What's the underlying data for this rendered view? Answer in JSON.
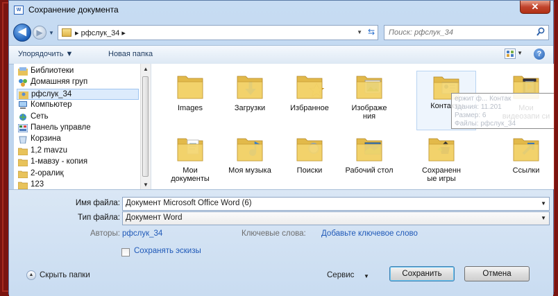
{
  "window": {
    "title": "Сохранение документа",
    "close_label": "✕"
  },
  "nav": {
    "crumb": "рфслук_34",
    "search_placeholder": "Поиск: рфслук_34"
  },
  "toolbar": {
    "organize_label": "Упорядочить ▼",
    "new_folder_label": "Новая папка"
  },
  "tree": {
    "items": [
      {
        "label": "Библиотеки",
        "icon": "libraries-icon"
      },
      {
        "label": "Домашняя груп",
        "icon": "homegroup-icon"
      },
      {
        "label": "рфслук_34",
        "icon": "user-folder-icon",
        "selected": true
      },
      {
        "label": "Компьютер",
        "icon": "computer-icon"
      },
      {
        "label": "Сеть",
        "icon": "network-icon"
      },
      {
        "label": "Панель управле",
        "icon": "control-panel-icon"
      },
      {
        "label": "Корзина",
        "icon": "recycle-bin-icon"
      },
      {
        "label": "1,2 mavzu",
        "icon": "folder-icon"
      },
      {
        "label": "1-мавзу - копия",
        "icon": "folder-icon"
      },
      {
        "label": "2-оралиқ",
        "icon": "folder-icon"
      },
      {
        "label": "123",
        "icon": "folder-icon"
      }
    ]
  },
  "files": [
    {
      "label": "Images",
      "icon": "folder-icon"
    },
    {
      "label": "Загрузки",
      "icon": "downloads-folder-icon"
    },
    {
      "label": "Избранное",
      "icon": "favorites-folder-icon"
    },
    {
      "label": "Изображе ния",
      "icon": "pictures-folder-icon"
    },
    {
      "label": "Контакты",
      "icon": "contacts-folder-icon"
    },
    {
      "label": "Мои видеозапи си",
      "icon": "videos-folder-icon"
    },
    {
      "label": "Мои документы",
      "icon": "documents-folder-icon"
    },
    {
      "label": "Моя музыка",
      "icon": "music-folder-icon"
    },
    {
      "label": "Поиски",
      "icon": "searches-folder-icon"
    },
    {
      "label": "Рабочий стол",
      "icon": "desktop-folder-icon"
    },
    {
      "label": "Сохраненн ые игры",
      "icon": "saved-games-folder-icon"
    },
    {
      "label": "Ссылки",
      "icon": "links-folder-icon"
    }
  ],
  "tooltip": {
    "lines": [
      "ержит ф... Контак",
      "здания: 11.201",
      "Размер: 6",
      "Файлы: рфслук_34"
    ]
  },
  "form": {
    "filename_label": "Имя файла:",
    "filename_value": "Документ Microsoft Office Word (6)",
    "filetype_label": "Тип файла:",
    "filetype_value": "Документ Word",
    "authors_label": "Авторы:",
    "authors_value": "рфслук_34",
    "keywords_label": "Ключевые слова:",
    "keywords_value": "Добавьте ключевое слово",
    "thumbnails_label": "Сохранять эскизы"
  },
  "footer": {
    "hide_folders_label": "Скрыть папки",
    "service_label": "Сервис",
    "save_label": "Сохранить",
    "cancel_label": "Отмена"
  }
}
